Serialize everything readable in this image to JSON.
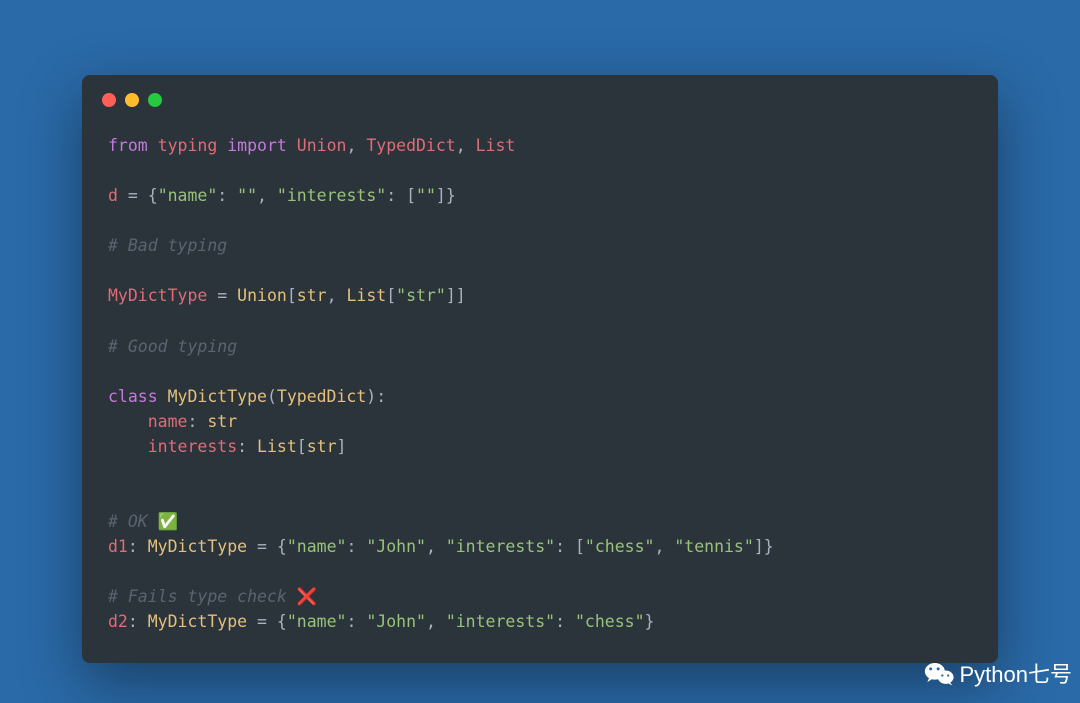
{
  "code": {
    "line1": {
      "from": "from",
      "typing": "typing",
      "import": "import",
      "union": "Union",
      "typeddict": "TypedDict",
      "list": "List"
    },
    "line2": {
      "d": "d",
      "eq": " = ",
      "open": "{",
      "k1": "\"name\"",
      "c1": ": ",
      "v1": "\"\"",
      "comma": ", ",
      "k2": "\"interests\"",
      "c2": ": [",
      "v2": "\"\"",
      "close": "]}"
    },
    "line3": {
      "text": "# Bad typing"
    },
    "line4": {
      "name": "MyDictType",
      "eq": " = ",
      "union": "Union",
      "b1": "[",
      "str": "str",
      "comma": ", ",
      "list": "List",
      "b2": "[",
      "str2": "\"str\"",
      "b3": "]]"
    },
    "line5": {
      "text": "# Good typing"
    },
    "line6a": {
      "class": "class",
      "name": "MyDictType",
      "p1": "(",
      "td": "TypedDict",
      "p2": "):"
    },
    "line6b": {
      "indent": "    ",
      "name": "name",
      "c": ": ",
      "type": "str"
    },
    "line6c": {
      "indent": "    ",
      "name": "interests",
      "c": ": ",
      "list": "List",
      "b1": "[",
      "str": "str",
      "b2": "]"
    },
    "line7": {
      "text": "# OK ",
      "emoji": "✅"
    },
    "line8": {
      "d": "d1",
      "c": ": ",
      "type": "MyDictType",
      "eq": " = {",
      "k1": "\"name\"",
      "c1": ": ",
      "v1": "\"John\"",
      "comma": ", ",
      "k2": "\"interests\"",
      "c2": ": [",
      "v2": "\"chess\"",
      "comma2": ", ",
      "v3": "\"tennis\"",
      "close": "]}"
    },
    "line9": {
      "text": "# Fails type check ",
      "emoji": "❌"
    },
    "line10": {
      "d": "d2",
      "c": ": ",
      "type": "MyDictType",
      "eq": " = {",
      "k1": "\"name\"",
      "c1": ": ",
      "v1": "\"John\"",
      "comma": ", ",
      "k2": "\"interests\"",
      "c2": ": ",
      "v2": "\"chess\"",
      "close": "}"
    }
  },
  "watermark": {
    "text": "Python七号"
  }
}
